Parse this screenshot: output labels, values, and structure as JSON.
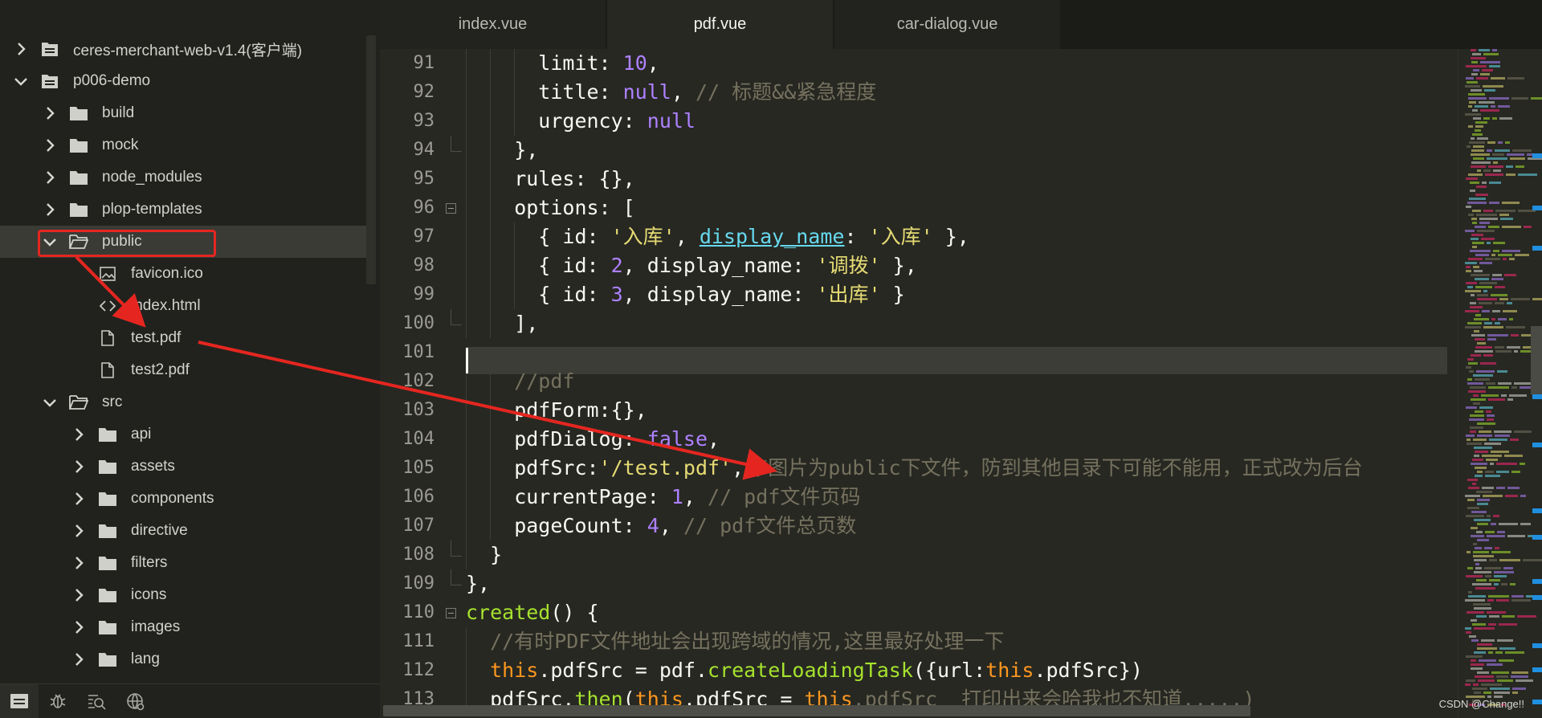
{
  "sidebar": {
    "tree": [
      {
        "label": "ceres-merchant-web-v1.4(客户端)",
        "depth": 0,
        "type": "project",
        "state": "collapsed"
      },
      {
        "label": "p006-demo",
        "depth": 0,
        "type": "project",
        "state": "expanded"
      },
      {
        "label": "build",
        "depth": 1,
        "type": "folder",
        "state": "collapsed"
      },
      {
        "label": "mock",
        "depth": 1,
        "type": "folder",
        "state": "collapsed"
      },
      {
        "label": "node_modules",
        "depth": 1,
        "type": "folder",
        "state": "collapsed"
      },
      {
        "label": "plop-templates",
        "depth": 1,
        "type": "folder",
        "state": "collapsed"
      },
      {
        "label": "public",
        "depth": 1,
        "type": "folder-open",
        "state": "expanded",
        "selected": true
      },
      {
        "label": "favicon.ico",
        "depth": 2,
        "type": "image-file"
      },
      {
        "label": "index.html",
        "depth": 2,
        "type": "code-file"
      },
      {
        "label": "test.pdf",
        "depth": 2,
        "type": "file"
      },
      {
        "label": "test2.pdf",
        "depth": 2,
        "type": "file"
      },
      {
        "label": "src",
        "depth": 1,
        "type": "folder-open",
        "state": "expanded"
      },
      {
        "label": "api",
        "depth": 2,
        "type": "folder",
        "state": "collapsed"
      },
      {
        "label": "assets",
        "depth": 2,
        "type": "folder",
        "state": "collapsed"
      },
      {
        "label": "components",
        "depth": 2,
        "type": "folder",
        "state": "collapsed"
      },
      {
        "label": "directive",
        "depth": 2,
        "type": "folder",
        "state": "collapsed"
      },
      {
        "label": "filters",
        "depth": 2,
        "type": "folder",
        "state": "collapsed"
      },
      {
        "label": "icons",
        "depth": 2,
        "type": "folder",
        "state": "collapsed"
      },
      {
        "label": "images",
        "depth": 2,
        "type": "folder",
        "state": "collapsed"
      },
      {
        "label": "lang",
        "depth": 2,
        "type": "folder",
        "state": "collapsed"
      }
    ],
    "footer_icons": [
      "files-icon",
      "debug-icon",
      "search-list-icon",
      "remote-icon"
    ]
  },
  "tabs": [
    {
      "label": "index.vue",
      "active": false
    },
    {
      "label": "pdf.vue",
      "active": true
    },
    {
      "label": "car-dialog.vue",
      "active": false
    }
  ],
  "editor": {
    "current_line": 101,
    "lines": [
      {
        "n": "91",
        "indent": 6,
        "tokens": [
          [
            "limit: ",
            ""
          ],
          [
            "10",
            "num"
          ],
          [
            ",",
            ""
          ]
        ]
      },
      {
        "n": "92",
        "indent": 6,
        "tokens": [
          [
            "title: ",
            ""
          ],
          [
            "null",
            "kw"
          ],
          [
            ", ",
            ""
          ],
          [
            "// 标题&&紧急程度",
            "com"
          ]
        ]
      },
      {
        "n": "93",
        "indent": 6,
        "tokens": [
          [
            "urgency: ",
            ""
          ],
          [
            "null",
            "kw"
          ]
        ]
      },
      {
        "n": "94",
        "indent": 4,
        "fold": "end",
        "tokens": [
          [
            "},",
            ""
          ]
        ]
      },
      {
        "n": "95",
        "indent": 4,
        "tokens": [
          [
            "rules: {},",
            ""
          ]
        ]
      },
      {
        "n": "96",
        "indent": 4,
        "fold": "start",
        "tokens": [
          [
            "options: [",
            ""
          ]
        ]
      },
      {
        "n": "97",
        "indent": 6,
        "tokens": [
          [
            "{ id: ",
            ""
          ],
          [
            "'入库'",
            "str"
          ],
          [
            ", ",
            ""
          ],
          [
            "display_name",
            "link"
          ],
          [
            ": ",
            ""
          ],
          [
            "'入库'",
            "str"
          ],
          [
            " },",
            ""
          ]
        ]
      },
      {
        "n": "98",
        "indent": 6,
        "tokens": [
          [
            "{ id: ",
            ""
          ],
          [
            "2",
            "num"
          ],
          [
            ", display_name: ",
            ""
          ],
          [
            "'调拨'",
            "str"
          ],
          [
            " },",
            ""
          ]
        ]
      },
      {
        "n": "99",
        "indent": 6,
        "tokens": [
          [
            "{ id: ",
            ""
          ],
          [
            "3",
            "num"
          ],
          [
            ", display_name: ",
            ""
          ],
          [
            "'出库'",
            "str"
          ],
          [
            " }",
            ""
          ]
        ]
      },
      {
        "n": "100",
        "indent": 4,
        "fold": "end",
        "tokens": [
          [
            "],",
            ""
          ]
        ]
      },
      {
        "n": "101",
        "indent": 0,
        "tokens": []
      },
      {
        "n": "102",
        "indent": 4,
        "tokens": [
          [
            "//pdf",
            "com"
          ]
        ]
      },
      {
        "n": "103",
        "indent": 4,
        "tokens": [
          [
            "pdfForm:{},",
            ""
          ]
        ]
      },
      {
        "n": "104",
        "indent": 4,
        "tokens": [
          [
            "pdfDialog: ",
            ""
          ],
          [
            "false",
            "kw"
          ],
          [
            ",",
            ""
          ]
        ]
      },
      {
        "n": "105",
        "indent": 4,
        "tokens": [
          [
            "pdfSrc:",
            ""
          ],
          [
            "'/test.pdf'",
            "str"
          ],
          [
            ",",
            ""
          ],
          [
            "//图片为public下文件，防到其他目录下可能不能用，正式改为后台",
            "com"
          ]
        ]
      },
      {
        "n": "106",
        "indent": 4,
        "tokens": [
          [
            "currentPage: ",
            ""
          ],
          [
            "1",
            "num"
          ],
          [
            ", ",
            ""
          ],
          [
            "// pdf文件页码",
            "com"
          ]
        ]
      },
      {
        "n": "107",
        "indent": 4,
        "tokens": [
          [
            "pageCount: ",
            ""
          ],
          [
            "4",
            "num"
          ],
          [
            ", ",
            ""
          ],
          [
            "// pdf文件总页数",
            "com"
          ]
        ]
      },
      {
        "n": "108",
        "indent": 2,
        "fold": "end",
        "tokens": [
          [
            "}",
            ""
          ]
        ]
      },
      {
        "n": "109",
        "indent": 0,
        "fold": "end",
        "tokens": [
          [
            "},",
            ""
          ]
        ]
      },
      {
        "n": "110",
        "indent": 0,
        "fold": "start",
        "tokens": [
          [
            "created",
            "fn"
          ],
          [
            "() {",
            ""
          ]
        ]
      },
      {
        "n": "111",
        "indent": 2,
        "tokens": [
          [
            "//有时PDF文件地址会出现跨域的情况,这里最好处理一下",
            "com"
          ]
        ]
      },
      {
        "n": "112",
        "indent": 2,
        "tokens": [
          [
            "this",
            "this"
          ],
          [
            ".pdfSrc = pdf.",
            ""
          ],
          [
            "createLoadingTask",
            "fn"
          ],
          [
            "({url:",
            ""
          ],
          [
            "this",
            "this"
          ],
          [
            ".pdfSrc})",
            ""
          ]
        ]
      },
      {
        "n": "113",
        "indent": 2,
        "tokens": [
          [
            "pdfSrc.",
            ""
          ],
          [
            "then",
            "fn"
          ],
          [
            "(",
            ""
          ],
          [
            "this",
            "this"
          ],
          [
            ".pdfSrc = ",
            ""
          ],
          [
            "this",
            "this"
          ],
          [
            ".pdfSrc  打印出来会哈我也不知道.....)",
            "com"
          ]
        ]
      }
    ]
  },
  "colors": {
    "background": "#272822",
    "sidebar": "#21221d",
    "annotation_red": "#e52620",
    "number": "#ae81ff",
    "string": "#e6db74",
    "comment": "#75715e",
    "function": "#a6e22e",
    "this": "#fd971f"
  },
  "watermark": "CSDN @Change!!"
}
